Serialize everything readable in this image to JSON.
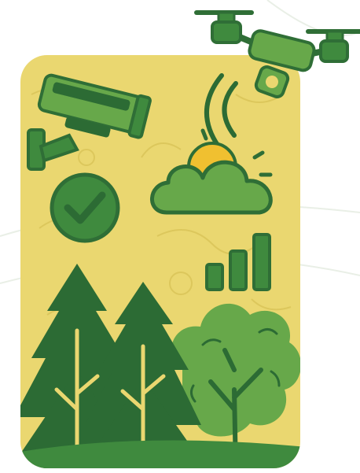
{
  "colors": {
    "background": "#ffffff",
    "card": "#ead770",
    "card_texture": "#dcc75c",
    "outline": "#2f6e36",
    "green_dark": "#2c6b34",
    "green_mid": "#3f8a3e",
    "green_light": "#67a84a",
    "sun": "#f0c030",
    "whisper": "#e9efe6"
  },
  "icons": [
    "security-camera-icon",
    "drone-icon",
    "wireless-signal-icon",
    "checkmark-circle-icon",
    "cloud-with-sun-icon",
    "bar-chart-icon",
    "pine-tree-icon",
    "deciduous-tree-icon"
  ],
  "signal_bars": [
    0.45,
    0.7,
    1.0
  ]
}
